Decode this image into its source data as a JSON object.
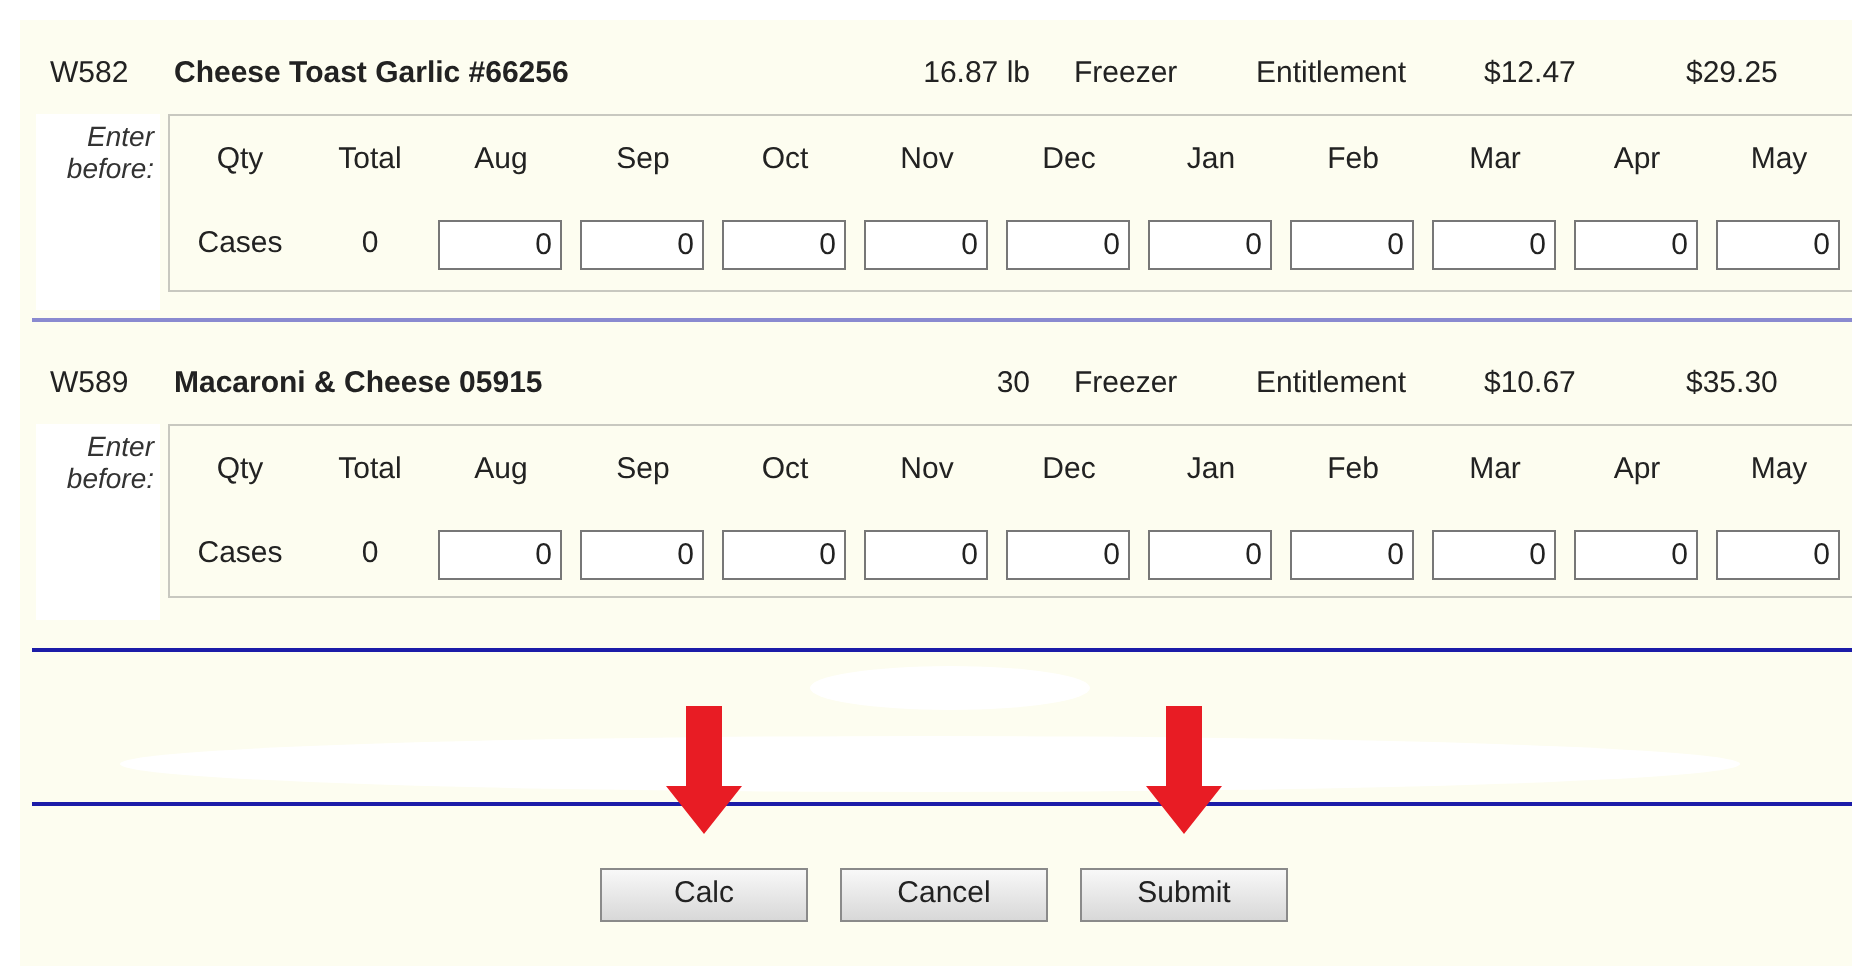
{
  "items": [
    {
      "code": "W582",
      "name": "Cheese Toast Garlic #66256",
      "weight": "16.87 lb",
      "storage": "Freezer",
      "program": "Entitlement",
      "price": "$12.47",
      "total": "$29.25",
      "enter_label": "Enter before:",
      "qty_header": "Qty",
      "total_header": "Total",
      "unit": "Cases",
      "total_qty": "0",
      "months": [
        {
          "label": "Aug",
          "value": "0"
        },
        {
          "label": "Sep",
          "value": "0"
        },
        {
          "label": "Oct",
          "value": "0"
        },
        {
          "label": "Nov",
          "value": "0"
        },
        {
          "label": "Dec",
          "value": "0"
        },
        {
          "label": "Jan",
          "value": "0"
        },
        {
          "label": "Feb",
          "value": "0"
        },
        {
          "label": "Mar",
          "value": "0"
        },
        {
          "label": "Apr",
          "value": "0"
        },
        {
          "label": "May",
          "value": "0"
        }
      ]
    },
    {
      "code": "W589",
      "name": "Macaroni & Cheese 05915",
      "weight": "30",
      "storage": "Freezer",
      "program": "Entitlement",
      "price": "$10.67",
      "total": "$35.30",
      "enter_label": "Enter before:",
      "qty_header": "Qty",
      "total_header": "Total",
      "unit": "Cases",
      "total_qty": "0",
      "months": [
        {
          "label": "Aug",
          "value": "0"
        },
        {
          "label": "Sep",
          "value": "0"
        },
        {
          "label": "Oct",
          "value": "0"
        },
        {
          "label": "Nov",
          "value": "0"
        },
        {
          "label": "Dec",
          "value": "0"
        },
        {
          "label": "Jan",
          "value": "0"
        },
        {
          "label": "Feb",
          "value": "0"
        },
        {
          "label": "Mar",
          "value": "0"
        },
        {
          "label": "Apr",
          "value": "0"
        },
        {
          "label": "May",
          "value": "0"
        }
      ]
    }
  ],
  "buttons": [
    {
      "label": "Calc",
      "arrow": true
    },
    {
      "label": "Cancel",
      "arrow": false
    },
    {
      "label": "Submit",
      "arrow": true
    }
  ]
}
